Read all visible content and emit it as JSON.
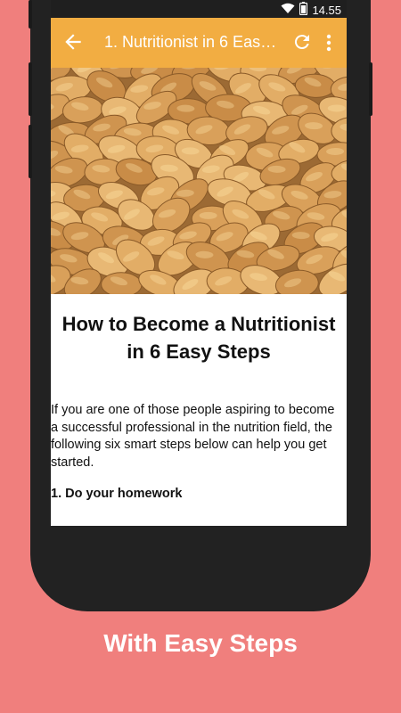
{
  "status_bar": {
    "time": "14.55",
    "icons": [
      "wifi-icon",
      "battery-icon"
    ]
  },
  "app_bar": {
    "title": "1. Nutritionist in 6 Easy Steps",
    "icons": [
      "back-arrow-icon",
      "refresh-icon",
      "more-vert-icon"
    ],
    "color": "#f2ad42"
  },
  "hero": {
    "image": "almonds-photo"
  },
  "article": {
    "title": "How to Become a Nutritionist in 6 Easy Steps",
    "intro": "If you are one of those people aspiring to become a successful professional in the nutrition field, the following six smart steps below can help you get started.",
    "step1_heading": "1. Do your homework"
  },
  "caption": "With Easy Steps",
  "colors": {
    "background": "#f07f7d",
    "phone": "#222222",
    "accent": "#f2ad42"
  }
}
